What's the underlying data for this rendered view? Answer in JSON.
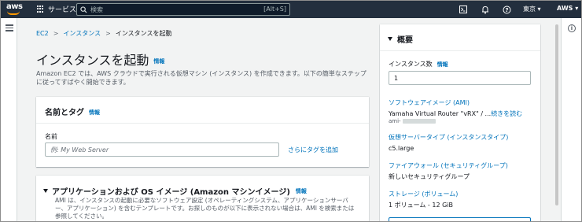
{
  "topnav": {
    "logo_text": "aws",
    "services_label": "サービス",
    "search_placeholder": "検索",
    "search_shortcut": "[Alt+S]",
    "region": "東京 ▾",
    "account": "AWS ▾",
    "icons": [
      "aws-logo",
      "grid-icon",
      "search-icon",
      "cloudshell-icon",
      "bell-icon",
      "help-icon"
    ]
  },
  "breadcrumb": [
    {
      "label": "EC2",
      "link": true
    },
    {
      "label": "インスタンス",
      "link": true
    },
    {
      "label": "インスタンスを起動",
      "link": false
    }
  ],
  "page": {
    "title": "インスタンスを起動",
    "info": "情報",
    "description": "Amazon EC2 では、AWS クラウドで実行される仮想マシン (インスタンス) を作成できます。以下の簡単なステップに従ってすばやく開始できます。"
  },
  "name_panel": {
    "title": "名前とタグ",
    "info": "情報",
    "field_label": "名前",
    "placeholder": "例: My Web Server",
    "add_tag": "さらにタグを追加"
  },
  "ami_panel": {
    "title": "アプリケーションおよび OS イメージ (Amazon マシンイメージ)",
    "info": "情報",
    "description": "AMI は、インスタンスの起動に必要なソフトウェア設定 (オペレーティングシステム、アプリケーションサーバー、アプリケーション) を含むテンプレートです。お探しのものが以下に表示されない場合は、AMI を検索または参照してください。"
  },
  "summary": {
    "title": "概要",
    "instance_count_label": "インスタンス数",
    "instance_count_info": "情報",
    "instance_count_value": "1",
    "ami_label": "ソフトウェアイメージ (AMI)",
    "ami_value": "Yamaha Virtual Router \"vRX\" / ...",
    "ami_more": "続きを読む",
    "ami_id_prefix": "ami-",
    "instance_type_label": "仮想サーバータイプ (インスタンスタイプ)",
    "instance_type_value": "c5.large",
    "firewall_label": "ファイアウォール (セキュリティグループ)",
    "firewall_value": "新しいセキュリティグループ",
    "storage_label": "ストレージ (ボリューム)",
    "storage_value": "1 ボリューム - 12 GiB"
  }
}
